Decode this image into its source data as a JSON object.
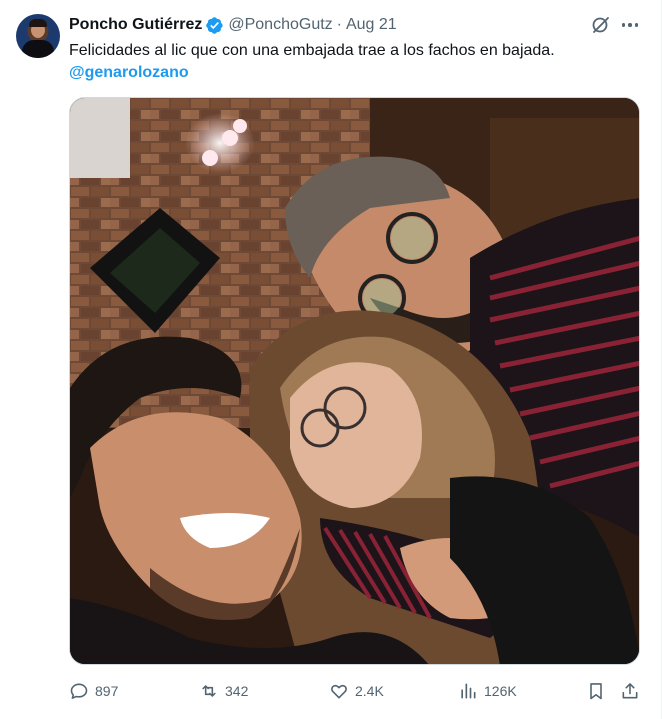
{
  "author": {
    "name": "Poncho Gutiérrez",
    "handle": "@PonchoGutz",
    "separator": "·",
    "date": "Aug 21"
  },
  "tweet": {
    "text": "Felicidades al lic que con una embajada trae a los fachos en bajada.",
    "mention": "@genarolozano"
  },
  "actions": {
    "replies": "897",
    "reposts": "342",
    "likes": "2.4K",
    "views": "126K"
  },
  "colors": {
    "accent": "#1d9bf0",
    "text": "#0f1419",
    "secondary": "#536471"
  },
  "icons": [
    "verified-badge-icon",
    "grok-icon",
    "more-icon",
    "reply-icon",
    "repost-icon",
    "like-icon",
    "views-icon",
    "bookmark-icon",
    "share-icon"
  ]
}
